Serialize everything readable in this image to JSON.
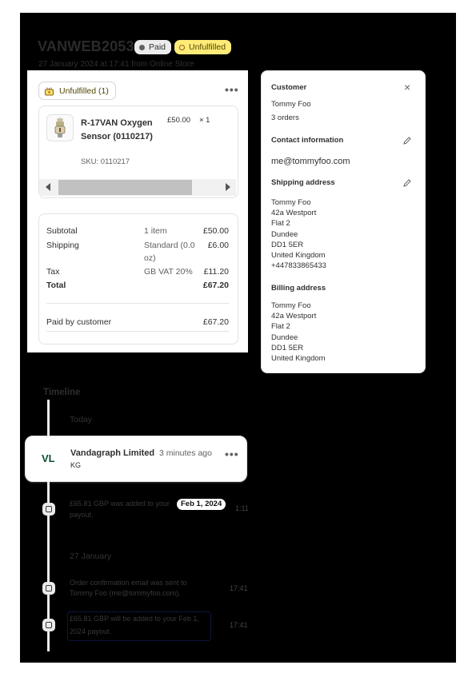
{
  "order": {
    "number": "VANWEB2053",
    "paid_badge": "Paid",
    "fulfillment_badge": "Unfulfilled",
    "subtitle": "27 January 2024 at 17:41 from Online Store"
  },
  "fulfillment_card": {
    "status_label": "Unfulfilled (1)",
    "more_label": "•••",
    "item": {
      "name": "R-17VAN Oxygen Sensor (0110217)",
      "sku": "SKU: 0110217",
      "price": "£50.00",
      "qty": "× 1",
      "thumbnail_icon": "oxygen-sensor-product-image"
    }
  },
  "payment_summary": {
    "rows": [
      {
        "label": "Subtotal",
        "detail": "1 item",
        "amount": "£50.00"
      },
      {
        "label": "Shipping",
        "detail": "Standard (0.0 oz)",
        "amount": "£6.00"
      },
      {
        "label": "Tax",
        "detail": "GB VAT 20%",
        "amount": "£11.20"
      },
      {
        "label": "Total",
        "detail": "",
        "amount": "£67.20"
      }
    ],
    "paid_by_customer": {
      "label": "Paid by customer",
      "amount": "£67.20"
    }
  },
  "customer_panel": {
    "heading": "Customer",
    "close_label": "×",
    "name": "Tommy Foo",
    "orders": "3 orders",
    "contact_heading": "Contact information",
    "email": "me@tommyfoo.com",
    "shipping_heading": "Shipping address",
    "shipping_lines": [
      "Tommy Foo",
      "42a Westport",
      "Flat 2",
      "Dundee",
      "DD1 5ER",
      "United Kingdom",
      "+447833865433"
    ],
    "billing_heading": "Billing address",
    "billing_lines": [
      "Tommy Foo",
      "42a Westport",
      "Flat 2",
      "Dundee",
      "DD1 5ER",
      "United Kingdom"
    ]
  },
  "timeline": {
    "heading": "Timeline",
    "today_label": "Today",
    "comment": {
      "avatar": "VL",
      "author": "Vandagraph Limited",
      "time_ago": "3 minutes ago",
      "initials": "KG",
      "more_label": "•••"
    },
    "events_today": [
      {
        "text_before": "£65.81 GBP was added to your",
        "date_chip": "Feb 1, 2024",
        "text_after": "payout.",
        "time": "1:11"
      }
    ],
    "jan_label": "27 January",
    "events_jan": [
      {
        "line1": "Order confirmation email was sent to",
        "line2": "Tommy Foo (me@tommyfoo.com).",
        "time": "17:41"
      },
      {
        "line1": "£65.81 GBP will be added to your Feb 1,",
        "line2": "2024 payout.",
        "time": "17:41"
      }
    ]
  },
  "colors": {
    "backdrop": "#000000",
    "unfulfilled_badge": "#ffeb78",
    "paid_badge": "#ececec",
    "avatar_text": "#0e4d2f"
  }
}
